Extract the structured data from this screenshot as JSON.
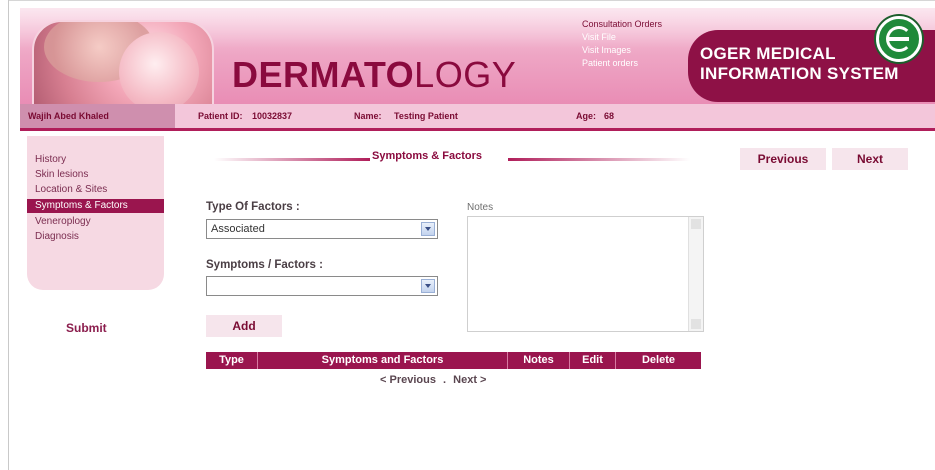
{
  "header": {
    "title_bold": "DERMATO",
    "title_thin": "LOGY",
    "links": [
      "Consultation Orders",
      "Visit File",
      "Visit Images",
      "Patient orders"
    ],
    "brand_line1": "OGER MEDICAL",
    "brand_line2": "INFORMATION SYSTEM"
  },
  "patient": {
    "user": "Wajih Abed Khaled",
    "id_label": "Patient ID:",
    "id_value": "10032837",
    "name_label": "Name:",
    "name_value": "Testing Patient",
    "age_label": "Age:",
    "age_value": "68"
  },
  "sidebar": {
    "items": [
      "History",
      "Skin lesions",
      "Location & Sites",
      "Symptoms & Factors",
      "Veneroplogy",
      "Diagnosis"
    ],
    "active_index": 3,
    "submit_label": "Submit"
  },
  "section": {
    "title": "Symptoms & Factors",
    "previous_label": "Previous",
    "next_label": "Next"
  },
  "form": {
    "type_label": "Type Of Factors :",
    "type_value": "Associated",
    "symptoms_label": "Symptoms / Factors :",
    "symptoms_value": "",
    "notes_label": "Notes",
    "add_label": "Add"
  },
  "table": {
    "columns": [
      "Type",
      "Symptoms and Factors",
      "Notes",
      "Edit",
      "Delete"
    ]
  },
  "pager": {
    "previous": "< Previous",
    "separator": ".",
    "next": "Next >"
  },
  "colors": {
    "accent": "#9a154e",
    "header_pink": "#eea5c4",
    "sidebar_bg": "#f6d9e3"
  }
}
